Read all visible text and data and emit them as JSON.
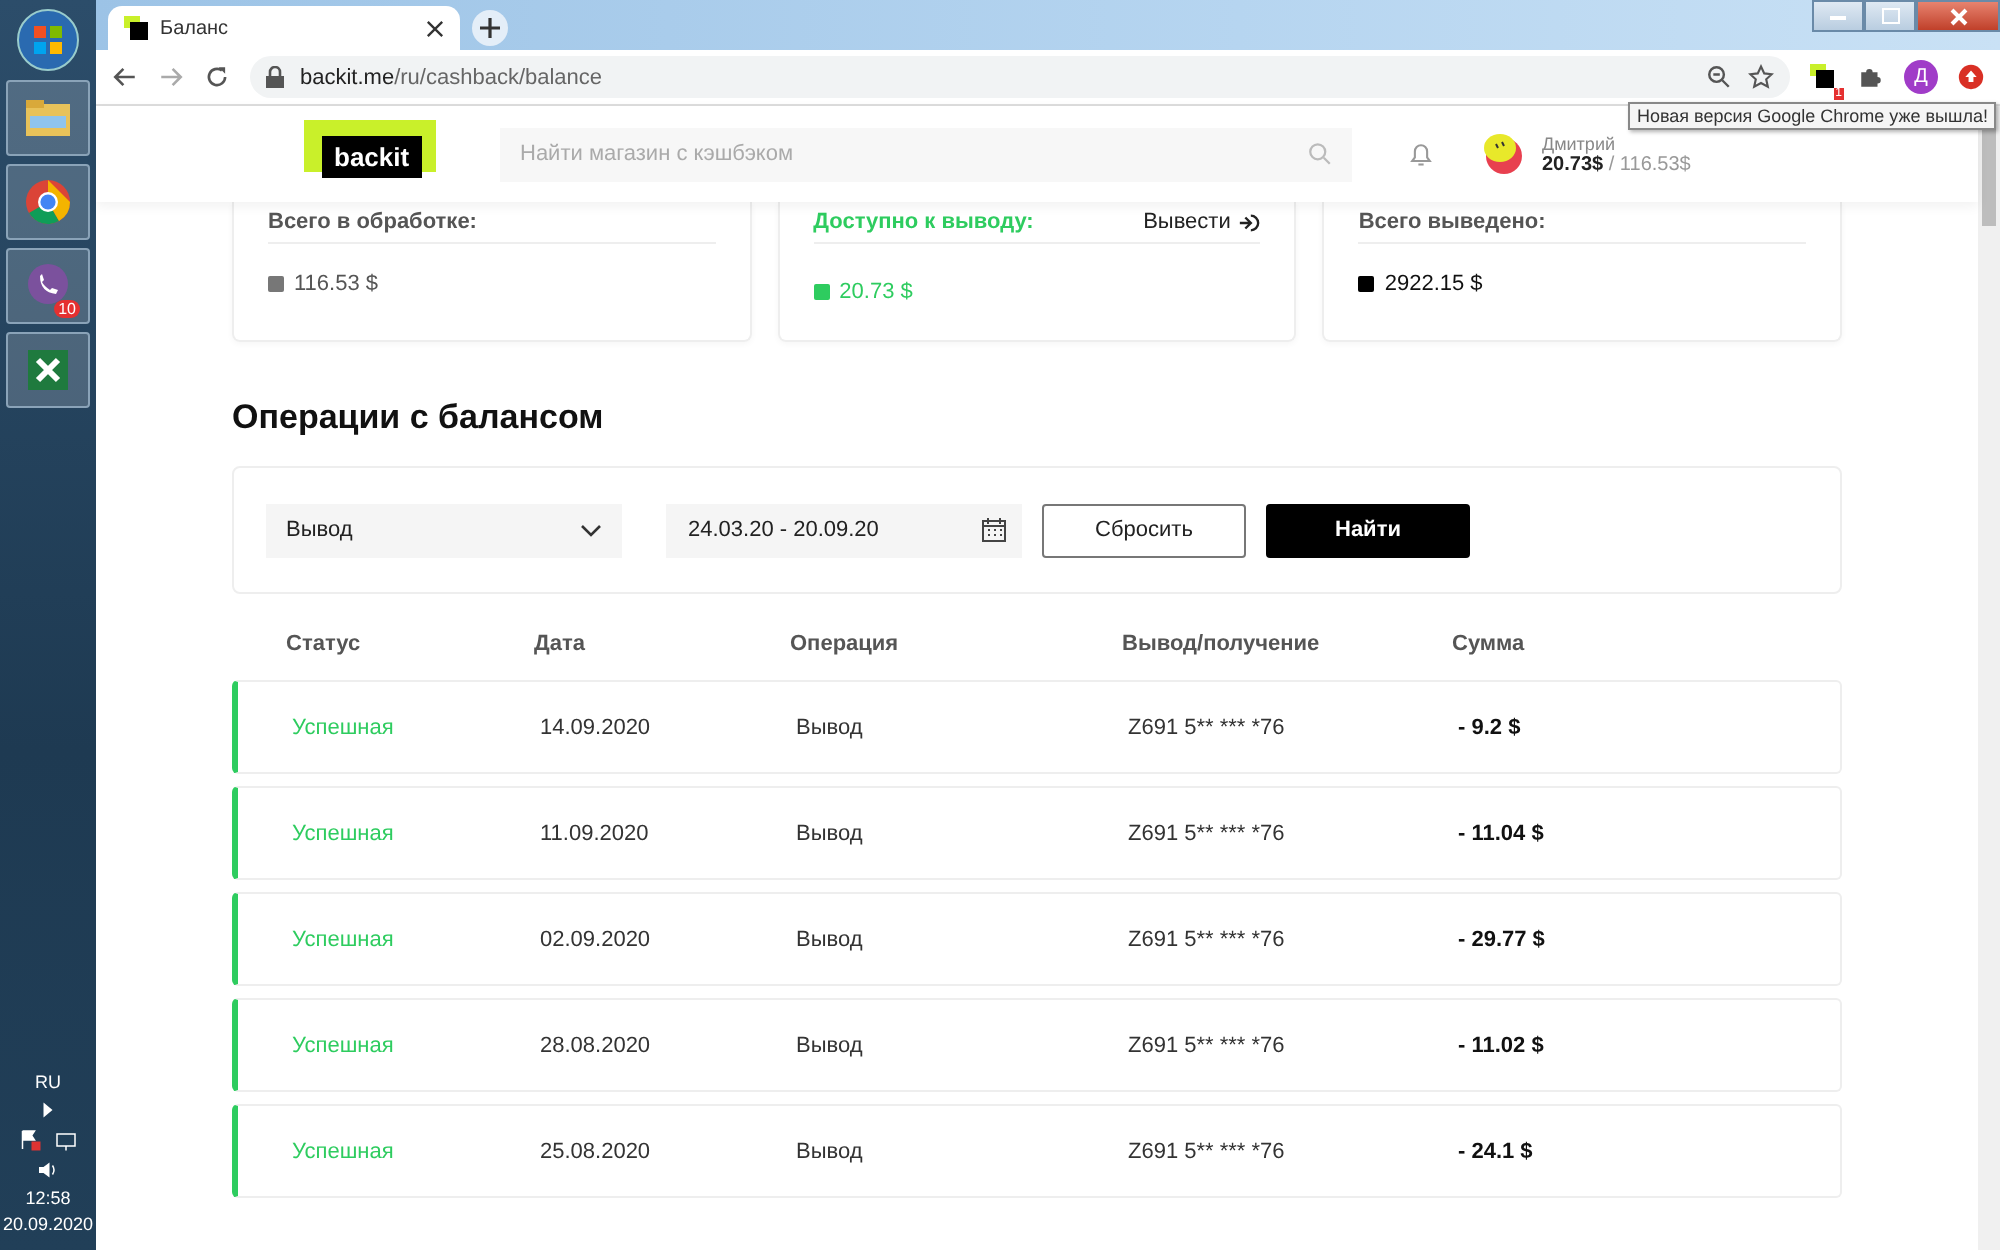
{
  "taskbar": {
    "app_badge": "10",
    "language": "RU",
    "time": "12:58",
    "date": "20.09.2020"
  },
  "browser": {
    "tab_title": "Баланс",
    "url_host": "backit.me",
    "url_path": "/ru/cashback/balance",
    "profile_initial": "Д",
    "extension_badge": "1",
    "tooltip": "Новая версия Google Chrome уже вышла!"
  },
  "header": {
    "logo": "backit",
    "search_placeholder": "Найти магазин с кэшбэком",
    "user_name": "Дмитрий",
    "balance": "20.73$",
    "balance_total": "/ 116.53$"
  },
  "cards": [
    {
      "label": "Всего в обработке:",
      "value": "116.53 $",
      "color": "#777777",
      "highlight": false
    },
    {
      "label": "Доступно к выводу:",
      "value": "20.73 $",
      "color": "#2ecc5f",
      "highlight": true,
      "action": "Вывести"
    },
    {
      "label": "Всего выведено:",
      "value": "2922.15 $",
      "color": "#000000",
      "highlight": false
    }
  ],
  "section_title": "Операции с балансом",
  "filter": {
    "operation": "Вывод",
    "date_range": "24.03.20 - 20.09.20",
    "reset": "Сбросить",
    "find": "Найти"
  },
  "table": {
    "columns": [
      "Статус",
      "Дата",
      "Операция",
      "Вывод/получение",
      "Сумма"
    ],
    "rows": [
      {
        "status": "Успешная",
        "date": "14.09.2020",
        "operation": "Вывод",
        "account": "Z691 5** *** *76",
        "amount": "- 9.2 $"
      },
      {
        "status": "Успешная",
        "date": "11.09.2020",
        "operation": "Вывод",
        "account": "Z691 5** *** *76",
        "amount": "- 11.04 $"
      },
      {
        "status": "Успешная",
        "date": "02.09.2020",
        "operation": "Вывод",
        "account": "Z691 5** *** *76",
        "amount": "- 29.77 $"
      },
      {
        "status": "Успешная",
        "date": "28.08.2020",
        "operation": "Вывод",
        "account": "Z691 5** *** *76",
        "amount": "- 11.02 $"
      },
      {
        "status": "Успешная",
        "date": "25.08.2020",
        "operation": "Вывод",
        "account": "Z691 5** *** *76",
        "amount": "- 24.1 $"
      }
    ]
  }
}
